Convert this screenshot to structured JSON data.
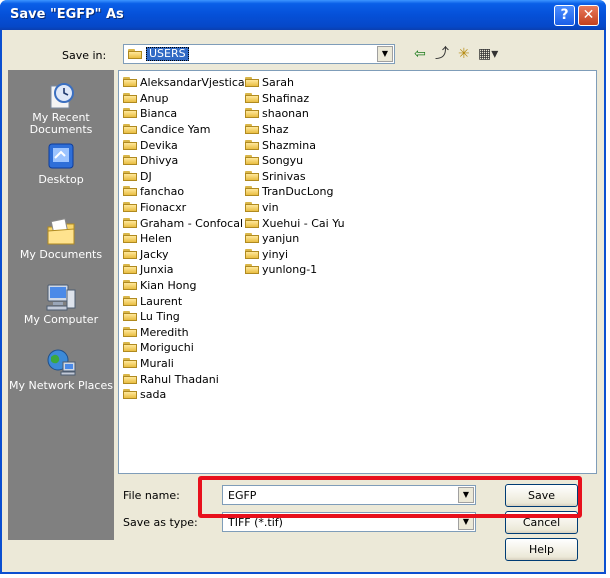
{
  "window": {
    "title": "Save \"EGFP\" As",
    "help_glyph": "?",
    "close_glyph": "✕"
  },
  "toolbar": {
    "save_in_label": "Save in:",
    "save_in_value": "USERS",
    "back_icon": "⇦",
    "up_icon": "⤴",
    "newfolder_icon": "✳",
    "views_icon": "▦▾"
  },
  "places": [
    {
      "label": "My Recent Documents",
      "icon": "recent-documents-icon"
    },
    {
      "label": "Desktop",
      "icon": "desktop-icon"
    },
    {
      "label": "My Documents",
      "icon": "my-documents-icon"
    },
    {
      "label": "My Computer",
      "icon": "my-computer-icon"
    },
    {
      "label": "My Network Places",
      "icon": "network-places-icon"
    }
  ],
  "files": {
    "column1": [
      "AleksandarVjestica",
      "Anup",
      "Bianca",
      "Candice Yam",
      "Devika",
      "Dhivya",
      "DJ",
      "fanchao",
      "Fionacxr",
      "Graham - Confocal",
      "Helen",
      "Jacky",
      "Junxia",
      "Kian Hong",
      "Laurent",
      "Lu Ting",
      "Meredith",
      "Moriguchi",
      "Murali",
      "Rahul Thadani",
      "sada"
    ],
    "column2": [
      "Sarah",
      "Shafinaz",
      "shaonan",
      "Shaz",
      "Shazmina",
      "Songyu",
      "Srinivas",
      "TranDucLong",
      "vin",
      "Xuehui - Cai Yu",
      "yanjun",
      "yinyi",
      "yunlong-1"
    ]
  },
  "form": {
    "filename_label": "File name:",
    "filename_value": "EGFP",
    "type_label": "Save as type:",
    "type_value": "TIFF (*.tif)",
    "dropdown_glyph": "▼"
  },
  "buttons": {
    "save": "Save",
    "cancel": "Cancel",
    "help": "Help"
  },
  "colors": {
    "titlebar": "#0550d8",
    "highlight": "#e8101c",
    "selection": "#316ac5"
  }
}
